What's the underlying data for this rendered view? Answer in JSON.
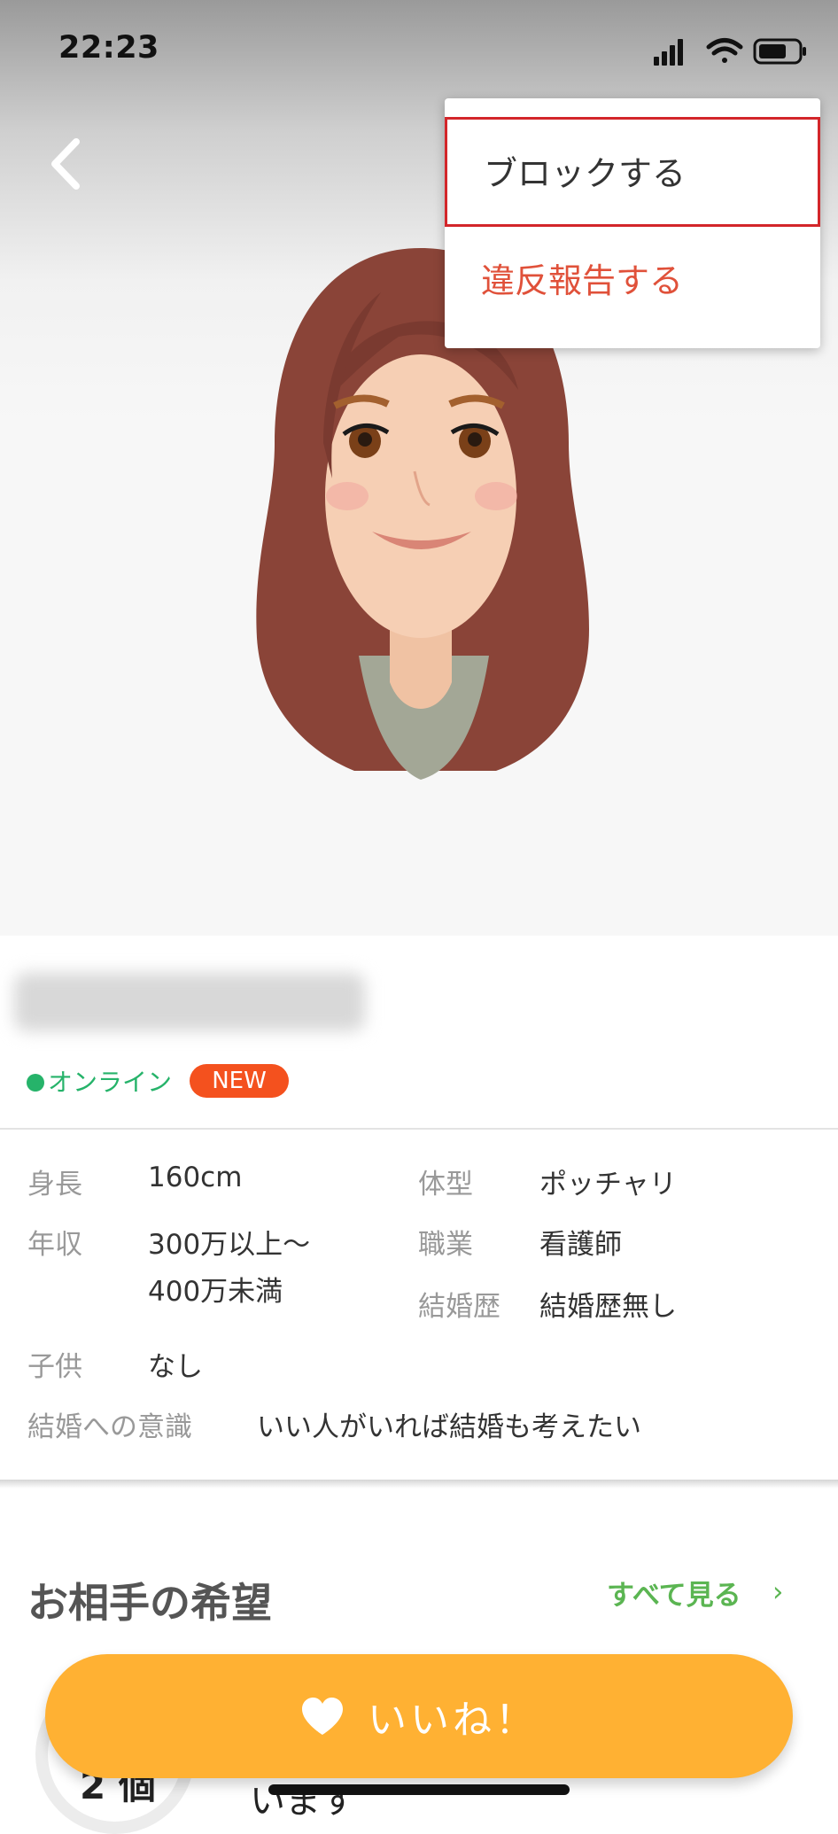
{
  "status_bar": {
    "time": "22:23"
  },
  "menu": {
    "block_label": "ブロックする",
    "report_label": "違反報告する"
  },
  "profile": {
    "online_label": "オンライン",
    "new_badge": "NEW",
    "details": [
      {
        "label": "身長",
        "value": "160cm"
      },
      {
        "label": "年収",
        "value_line1": "300万以上〜",
        "value_line2": "400万未満"
      },
      {
        "label": "子供",
        "value": "なし"
      },
      {
        "label": "体型",
        "value": "ポッチャリ"
      },
      {
        "label": "職業",
        "value": "看護師"
      },
      {
        "label": "結婚歴",
        "value": "結婚歴無し"
      },
      {
        "label": "結婚への意識",
        "value": "いい人がいれば結婚も考えたい"
      }
    ]
  },
  "wishes": {
    "title": "お相手の希望",
    "see_all": "すべて見る",
    "chevron": "›",
    "count_text": "2 個",
    "partial_text": "います"
  },
  "like_button": {
    "label": "いいね！"
  },
  "colors": {
    "accent_orange": "#ffb133",
    "online_green": "#26b36a",
    "new_badge": "#f4511e",
    "report_red": "#e0513a",
    "see_all_green": "#5bb552"
  },
  "icons": {
    "back": "chevron-left-icon",
    "heart": "heart-icon",
    "signal": "signal-icon",
    "wifi": "wifi-icon",
    "battery": "battery-icon"
  }
}
